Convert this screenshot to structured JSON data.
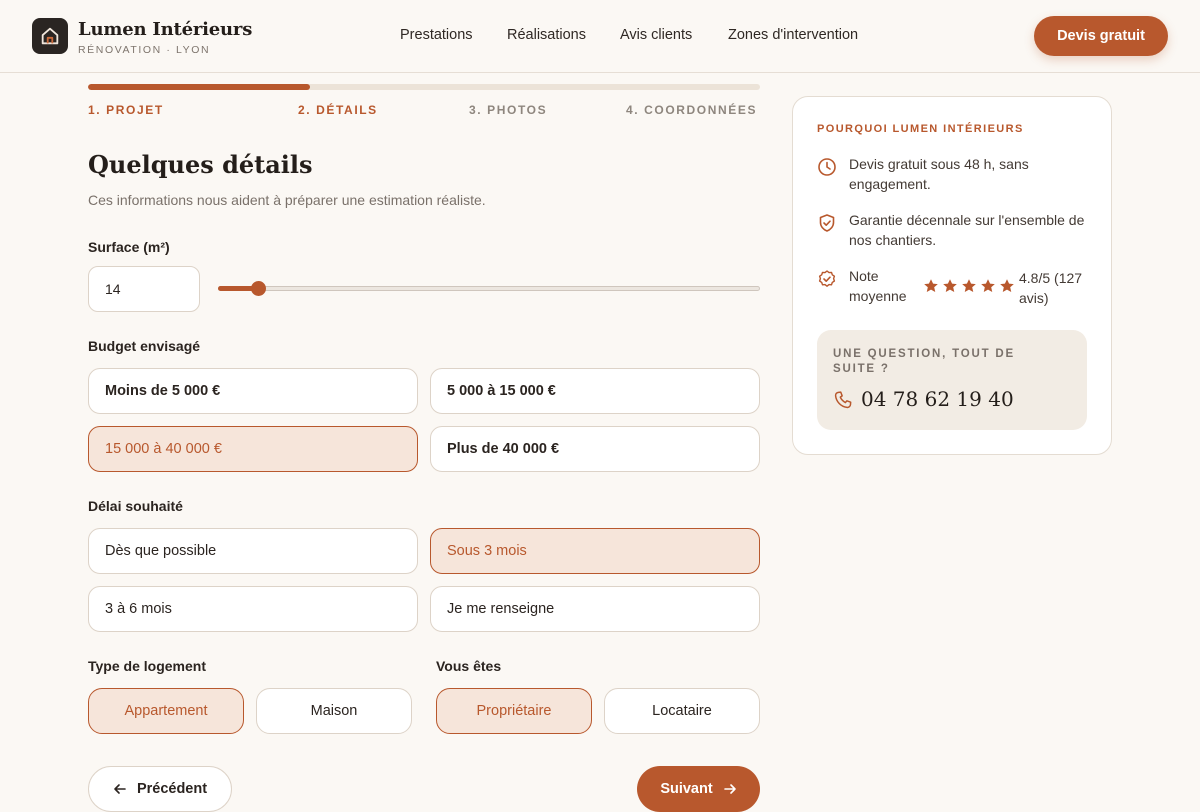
{
  "brand": {
    "name": "Lumen Intérieurs",
    "subtitle": "RÉNOVATION · LYON"
  },
  "nav": [
    {
      "label": "Prestations"
    },
    {
      "label": "Réalisations"
    },
    {
      "label": "Avis clients"
    },
    {
      "label": "Zones d'intervention"
    }
  ],
  "header_cta": "Devis gratuit",
  "progress": {
    "current_step": 2,
    "total_steps": 4,
    "fraction": 0.33
  },
  "steps": [
    "1. PROJET",
    "2. DÉTAILS",
    "3. PHOTOS",
    "4. COORDONNÉES"
  ],
  "form": {
    "title": "Quelques détails",
    "subtitle": "Ces informations nous aident à préparer une estimation réaliste.",
    "surface": {
      "label": "Surface (m²)",
      "value": "14",
      "slider_fraction": 0.074
    },
    "budget": {
      "label": "Budget envisagé",
      "options": [
        "Moins de 5 000 €",
        "5 000 à 15 000 €",
        "15 000 à 40 000 €",
        "Plus de 40 000 €"
      ],
      "selected": "15 000 à 40 000 €"
    },
    "delay": {
      "label": "Délai souhaité",
      "options": [
        "Dès que possible",
        "Sous 3 mois",
        "3 à 6 mois",
        "Je me renseigne"
      ],
      "selected": "Sous 3 mois"
    },
    "housing": {
      "label": "Type de logement",
      "options": [
        "Appartement",
        "Maison"
      ],
      "selected": "Appartement"
    },
    "status": {
      "label": "Vous êtes",
      "options": [
        "Propriétaire",
        "Locataire"
      ],
      "selected": "Propriétaire"
    },
    "prev_label": "Précédent",
    "next_label": "Suivant"
  },
  "sidebar": {
    "heading": "POURQUOI LUMEN INTÉRIEURS",
    "items": [
      {
        "icon": "clock-icon",
        "text": "Devis gratuit sous 48 h, sans engagement."
      },
      {
        "icon": "shield-check-icon",
        "text": "Garantie décennale sur l'ensemble de nos chantiers."
      }
    ],
    "rating": {
      "label": "Note moyenne",
      "stars": 5,
      "value": "4.8/5 (127 avis)"
    },
    "question": {
      "heading": "UNE QUESTION, TOUT DE SUITE ?",
      "phone": "04 78 62 19 40"
    }
  },
  "colors": {
    "accent": "#b8582d",
    "accent_light": "#f6e5da",
    "background": "#fbf8f4",
    "dark": "#2a2522"
  }
}
